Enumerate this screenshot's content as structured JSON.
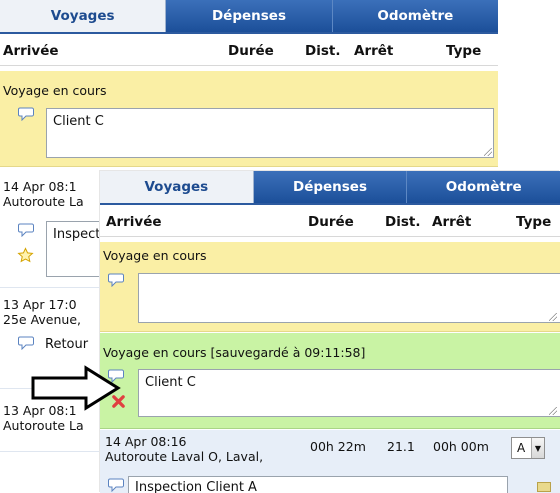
{
  "tabs": [
    "Voyages",
    "Dépenses",
    "Odomètre"
  ],
  "columns": {
    "arrivee": "Arrivée",
    "duree": "Durée",
    "dist": "Dist.",
    "arret": "Arrêt",
    "type": "Type"
  },
  "back": {
    "current": {
      "label": "Voyage en cours",
      "note": "Client C"
    },
    "trips": [
      {
        "date": "14 Apr 08:1",
        "place": "Autoroute La",
        "note": "Inspect"
      },
      {
        "date": "13 Apr 17:0",
        "place": "25e Avenue,",
        "note": "Retour"
      },
      {
        "date": "13 Apr 08:1",
        "place": "Autoroute La"
      }
    ]
  },
  "front": {
    "current": {
      "label": "Voyage en cours",
      "note": ""
    },
    "saved": {
      "label": "Voyage en cours [sauvegardé à 09:11:58]",
      "note": "Client C"
    },
    "trip": {
      "date": "14 Apr 08:16",
      "place": "Autoroute Laval O, Laval,",
      "duration": "00h 22m",
      "distance": "21.1",
      "stop": "00h 00m",
      "type": "A",
      "note": "Inspection Client A"
    }
  },
  "icons": {
    "comment": "speech-bubble-icon",
    "favorite": "star-icon",
    "delete": "red-x-icon",
    "pointer": "right-arrow-icon"
  },
  "colors": {
    "tab_active_text": "#1d4b8f",
    "tab_bar": "#2c5a9f",
    "current_trip_bg": "#faefa5",
    "saved_trip_bg": "#c9f3a4",
    "trip_row_bg": "#e7eef8",
    "delete": "#e04040"
  }
}
